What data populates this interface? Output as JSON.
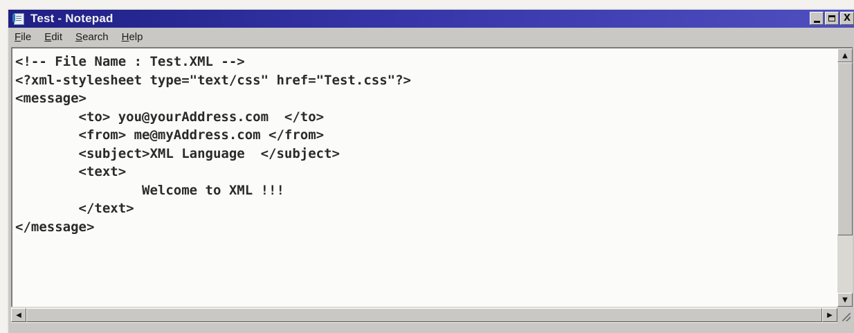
{
  "window": {
    "title": "Test - Notepad",
    "icon": "notepad-icon",
    "controls": {
      "minimize_icon": "minimize-icon",
      "maximize_icon": "maximize-icon",
      "close_glyph": "X"
    }
  },
  "menubar": {
    "items": [
      "File",
      "Edit",
      "Search",
      "Help"
    ]
  },
  "editor": {
    "lines": [
      "<!-- File Name : Test.XML -->",
      "<?xml-stylesheet type=\"text/css\" href=\"Test.css\"?>",
      "<message>",
      "        <to> you@yourAddress.com  </to>",
      "        <from> me@myAddress.com </from>",
      "        <subject>XML Language  </subject>",
      "        <text>",
      "                Welcome to XML !!!",
      "        </text>",
      "</message>"
    ]
  },
  "scrollbars": {
    "up_arrow": "▲",
    "down_arrow": "▼",
    "left_arrow": "◀",
    "right_arrow": "▶"
  },
  "colors": {
    "titlebar_start": "#1f1f85",
    "titlebar_end": "#4f4fc0",
    "chrome": "#c9c8c4",
    "editor_bg": "#fbfbf9"
  }
}
